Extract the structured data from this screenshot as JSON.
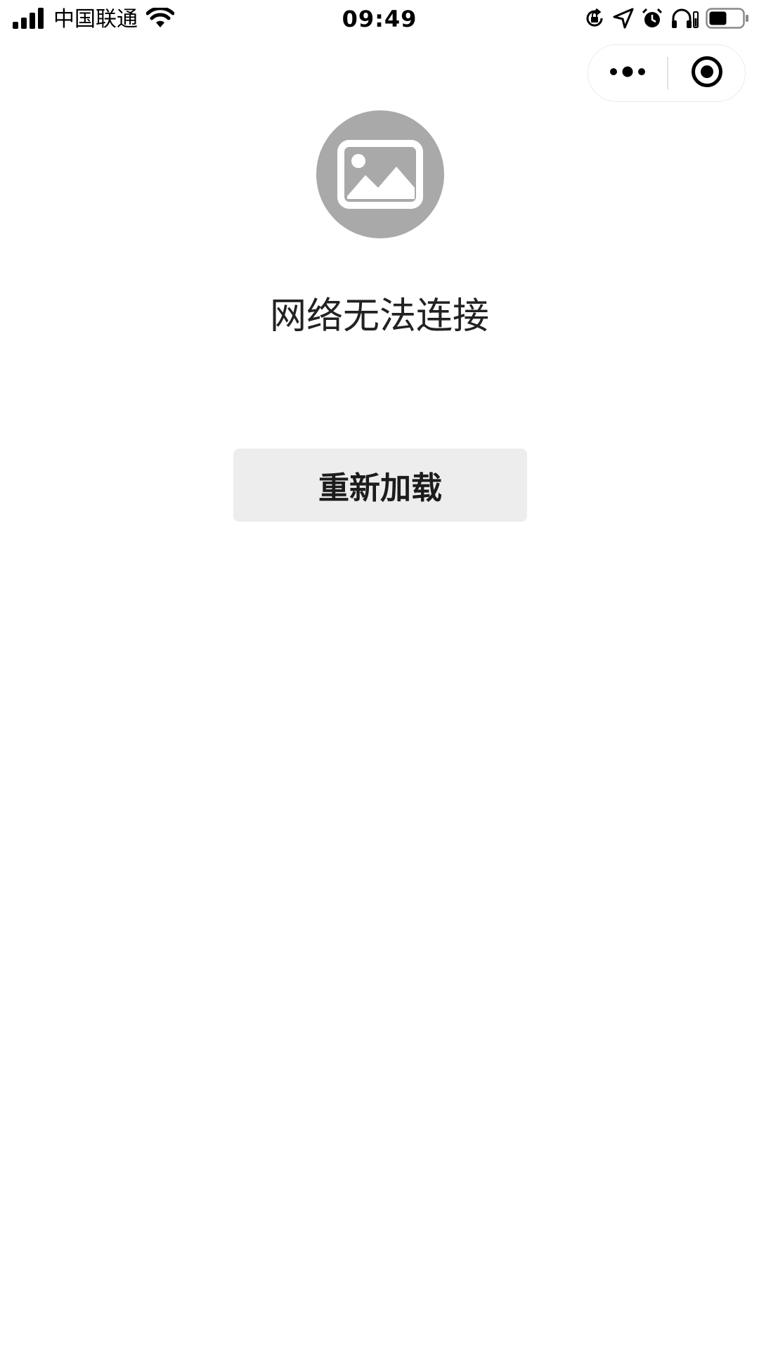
{
  "status_bar": {
    "carrier": "中国联通",
    "time": "09:49",
    "icons": [
      "signal-icon",
      "wifi-icon",
      "orientation-lock-icon",
      "location-icon",
      "alarm-icon",
      "headphones-icon",
      "battery-icon"
    ]
  },
  "capsule": {
    "more_icon": "more-dots-icon",
    "close_icon": "close-target-icon"
  },
  "error": {
    "image_icon": "image-placeholder-icon",
    "message": "网络无法连接",
    "reload_label": "重新加载"
  },
  "colors": {
    "background": "#ffffff",
    "placeholder_circle": "#a9a9a9",
    "button_bg": "#ededed",
    "text": "#222222"
  }
}
